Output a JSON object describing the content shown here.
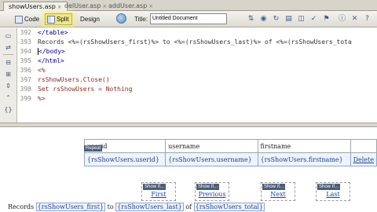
{
  "tabs": [
    {
      "label": "showUsers.asp",
      "active": true
    },
    {
      "label": "delUser.asp",
      "active": false
    },
    {
      "label": "addUser.asp",
      "active": false
    }
  ],
  "toolbar": {
    "code_label": "Code",
    "split_label": "Split",
    "design_label": "Design",
    "title_label": "Title:",
    "title_value": "Untitled Document",
    "active_view": "Split"
  },
  "code": {
    "lines": [
      {
        "num": "392",
        "text": "</table>"
      },
      {
        "num": "393",
        "text": "Records <%=(rsShowUsers_first)%> to <%=(rsShowUsers_last)%> of <%=(rsShowUsers_tota"
      },
      {
        "num": "394",
        "text": "</body>"
      },
      {
        "num": "395",
        "text": "</html>"
      },
      {
        "num": "396",
        "text": "<%"
      },
      {
        "num": "397",
        "text": "rsShowUsers.Close()"
      },
      {
        "num": "398",
        "text": "Set rsShowUsers = Nothing"
      },
      {
        "num": "399",
        "text": "%>"
      }
    ]
  },
  "design": {
    "region_tag": "Repeat",
    "table": {
      "headers": [
        "userid",
        "username",
        "firstname",
        ""
      ],
      "row": [
        "{rsShowUsers.userid}",
        "{rsShowUsers.username}",
        "{rsShowUsers.firstname}",
        "Delete"
      ]
    },
    "nav": [
      {
        "tag": "Show If...",
        "label": "First"
      },
      {
        "tag": "Show If...",
        "label": "Previous"
      },
      {
        "tag": "Show If...",
        "label": "Next"
      },
      {
        "tag": "Show If...",
        "label": "Last"
      }
    ],
    "records": {
      "prefix": "Records",
      "first": "{rsShowUsers_first}",
      "to": "to",
      "last": "{rsShowUsers_last}",
      "of": "of",
      "total": "{rsShowUsers_total}"
    }
  },
  "colors": {
    "accent": "#efe88a",
    "dynamic_text": "#1a3f8f",
    "link": "#1a3fa8"
  }
}
